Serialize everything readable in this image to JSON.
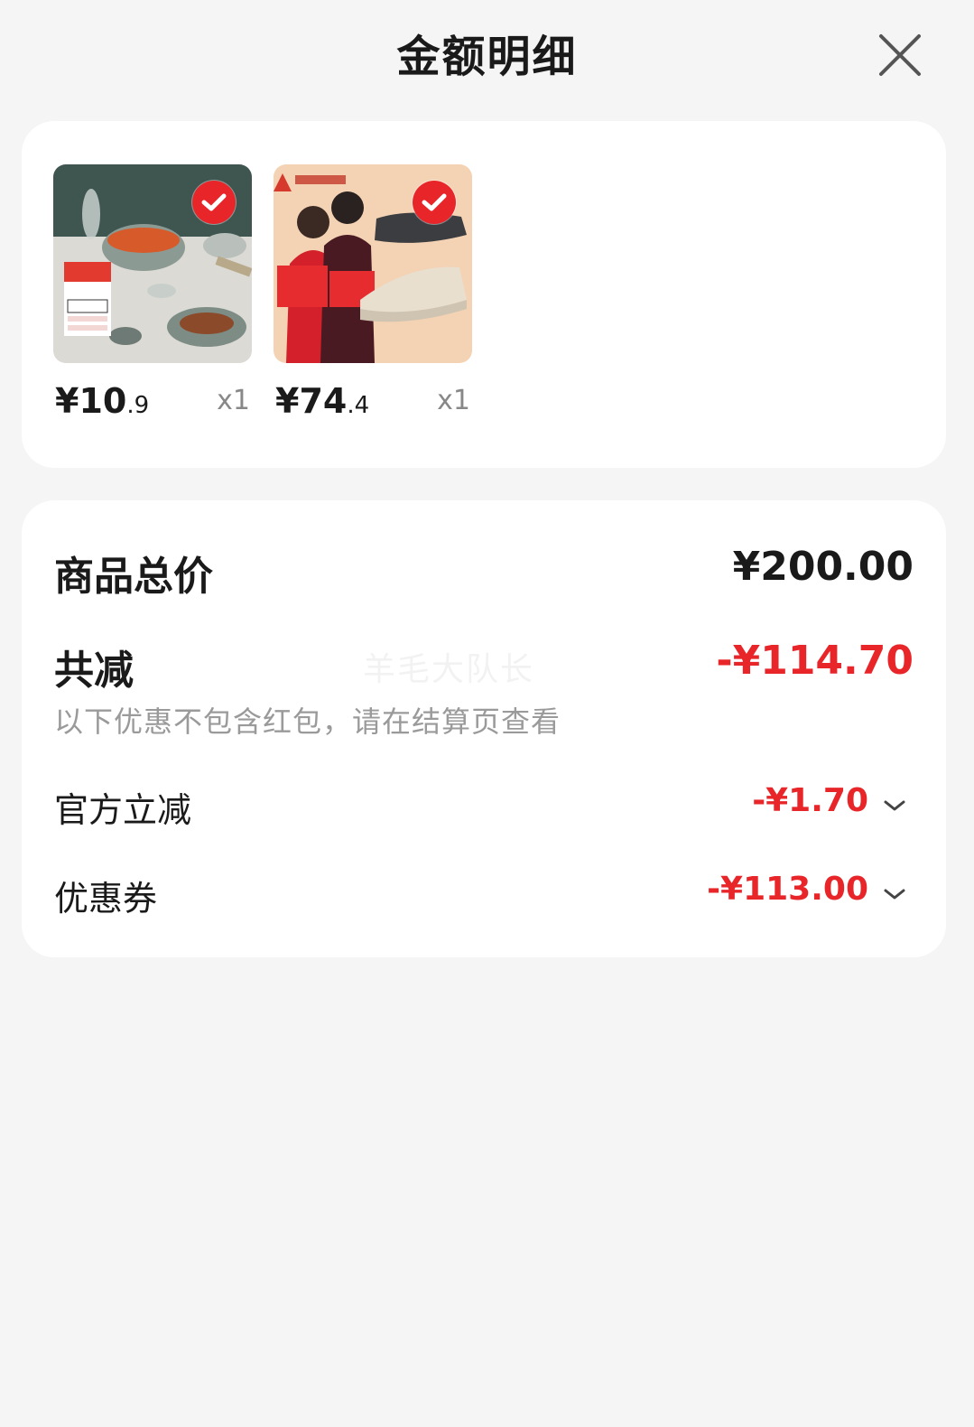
{
  "header": {
    "title": "金额明细"
  },
  "products": [
    {
      "image_alt": "tableware bowls and plates",
      "price_yen": "¥",
      "price_int": "10",
      "price_dec": ".9",
      "quantity": "x1",
      "selected": true
    },
    {
      "image_alt": "elderly shoes",
      "price_yen": "¥",
      "price_int": "74",
      "price_dec": ".4",
      "quantity": "x1",
      "selected": true
    }
  ],
  "summary": {
    "total_label": "商品总价",
    "total_value": "¥200.00",
    "discount_label": "共减",
    "discount_value": "-¥114.70",
    "note": "以下优惠不包含红包，请在结算页查看",
    "watermark": "羊毛大队长",
    "items": [
      {
        "label": "官方立减",
        "value": "-¥1.70"
      },
      {
        "label": "优惠券",
        "value": "-¥113.00"
      }
    ]
  },
  "colors": {
    "accent_red": "#e8262a",
    "background": "#f5f5f5",
    "card": "#ffffff"
  },
  "icons": {
    "close": "close-icon",
    "check": "check-icon",
    "expand": "chevron-down-icon"
  }
}
